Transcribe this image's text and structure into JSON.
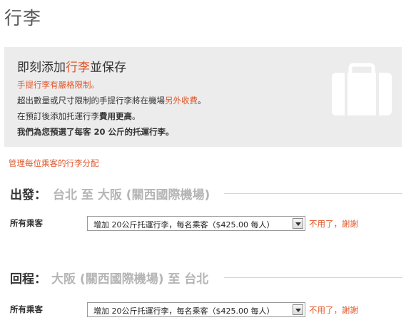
{
  "page": {
    "title": "行李"
  },
  "promo": {
    "title_prefix": "即刻添加",
    "title_highlight": "行李",
    "title_suffix": "並保存",
    "line1": "手提行李有嚴格限制。",
    "line2_prefix": "超出數量或尺寸限制的手提行李將在機場",
    "line2_highlight": "另外收費",
    "line2_suffix": "。",
    "line3_prefix": "在預訂後添加托運行李",
    "line3_bold": "費用更高",
    "line3_suffix": "。",
    "line4": "我們為您預選了每客 20 公斤的托運行李。",
    "icon": "luggage-icon"
  },
  "manage_link": "管理每位乘客的行李分配",
  "outbound": {
    "label": "出發：",
    "route": "台北 至 大阪 (關西國際機場)",
    "passenger_label": "所有乘客",
    "selected_option": "增加 20公斤托運行李，每名乘客（$425.00 每人）",
    "no_thanks": "不用了，謝謝"
  },
  "return": {
    "label": "回程：",
    "route": "大阪 (關西國際機場) 至 台北",
    "passenger_label": "所有乘客",
    "selected_option": "增加 20公斤托運行李，每名乘客（$425.00 每人）",
    "no_thanks": "不用了，謝謝"
  },
  "colors": {
    "accent": "#e0562a",
    "panel": "#ececec",
    "muted": "#b5b5b5"
  }
}
